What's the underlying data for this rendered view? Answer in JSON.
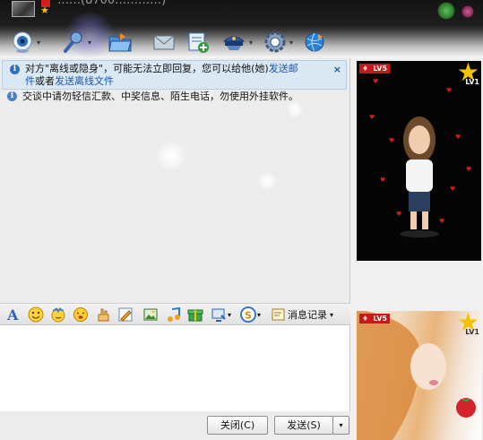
{
  "title": {
    "text": "……(8700…………)"
  },
  "toolbar": {
    "buttons": [
      {
        "name": "video-button",
        "icon": "webcam-icon",
        "has_menu": true
      },
      {
        "name": "voice-button",
        "icon": "microphone-icon",
        "has_menu": true
      },
      {
        "name": "file-button",
        "icon": "folder-icon",
        "has_menu": false
      },
      {
        "name": "mail-button",
        "icon": "envelope-icon",
        "has_menu": false
      },
      {
        "name": "add-button",
        "icon": "add-note-icon",
        "has_menu": false
      },
      {
        "name": "security-button",
        "icon": "police-hat-icon",
        "has_menu": true
      },
      {
        "name": "settings-button",
        "icon": "gear-icon",
        "has_menu": true
      },
      {
        "name": "apps-button",
        "icon": "globe-icon",
        "has_menu": false
      }
    ]
  },
  "messages": {
    "offline_notice": {
      "line1_prefix": "对方\"离线或隐身\"，可能无法立即回复，您可以给他(她)",
      "link_email_a": "发送邮",
      "link_email_b": "件",
      "line2_middle": "或者",
      "link_offline_file": "发送离线文件",
      "close_label": "×"
    },
    "security_notice": "交谈中请勿轻信汇款、中奖信息、陌生电话，勿使用外挂软件。"
  },
  "input_toolbar": {
    "history_label": "消息记录",
    "tools": [
      "font-icon",
      "smiley-icon",
      "magic-face-icon",
      "shake-icon",
      "gesture-icon",
      "doodle-icon",
      "picture-icon",
      "music-icon",
      "gift-icon",
      "screenshot-icon",
      "s-plugin-icon",
      "history-icon"
    ]
  },
  "buttons": {
    "close_label": "关闭(C)",
    "send_label": "发送(S)",
    "send_menu_label": "▾"
  },
  "side": {
    "show1": {
      "level": "LV5",
      "badge": "LV1"
    },
    "show2": {
      "level": "LV5",
      "badge": "LV1"
    }
  },
  "colors": {
    "notice_bg": "#d9e8f3",
    "link": "#1a55b8",
    "level_badge": "#c3191b",
    "star": "#f3c300"
  }
}
